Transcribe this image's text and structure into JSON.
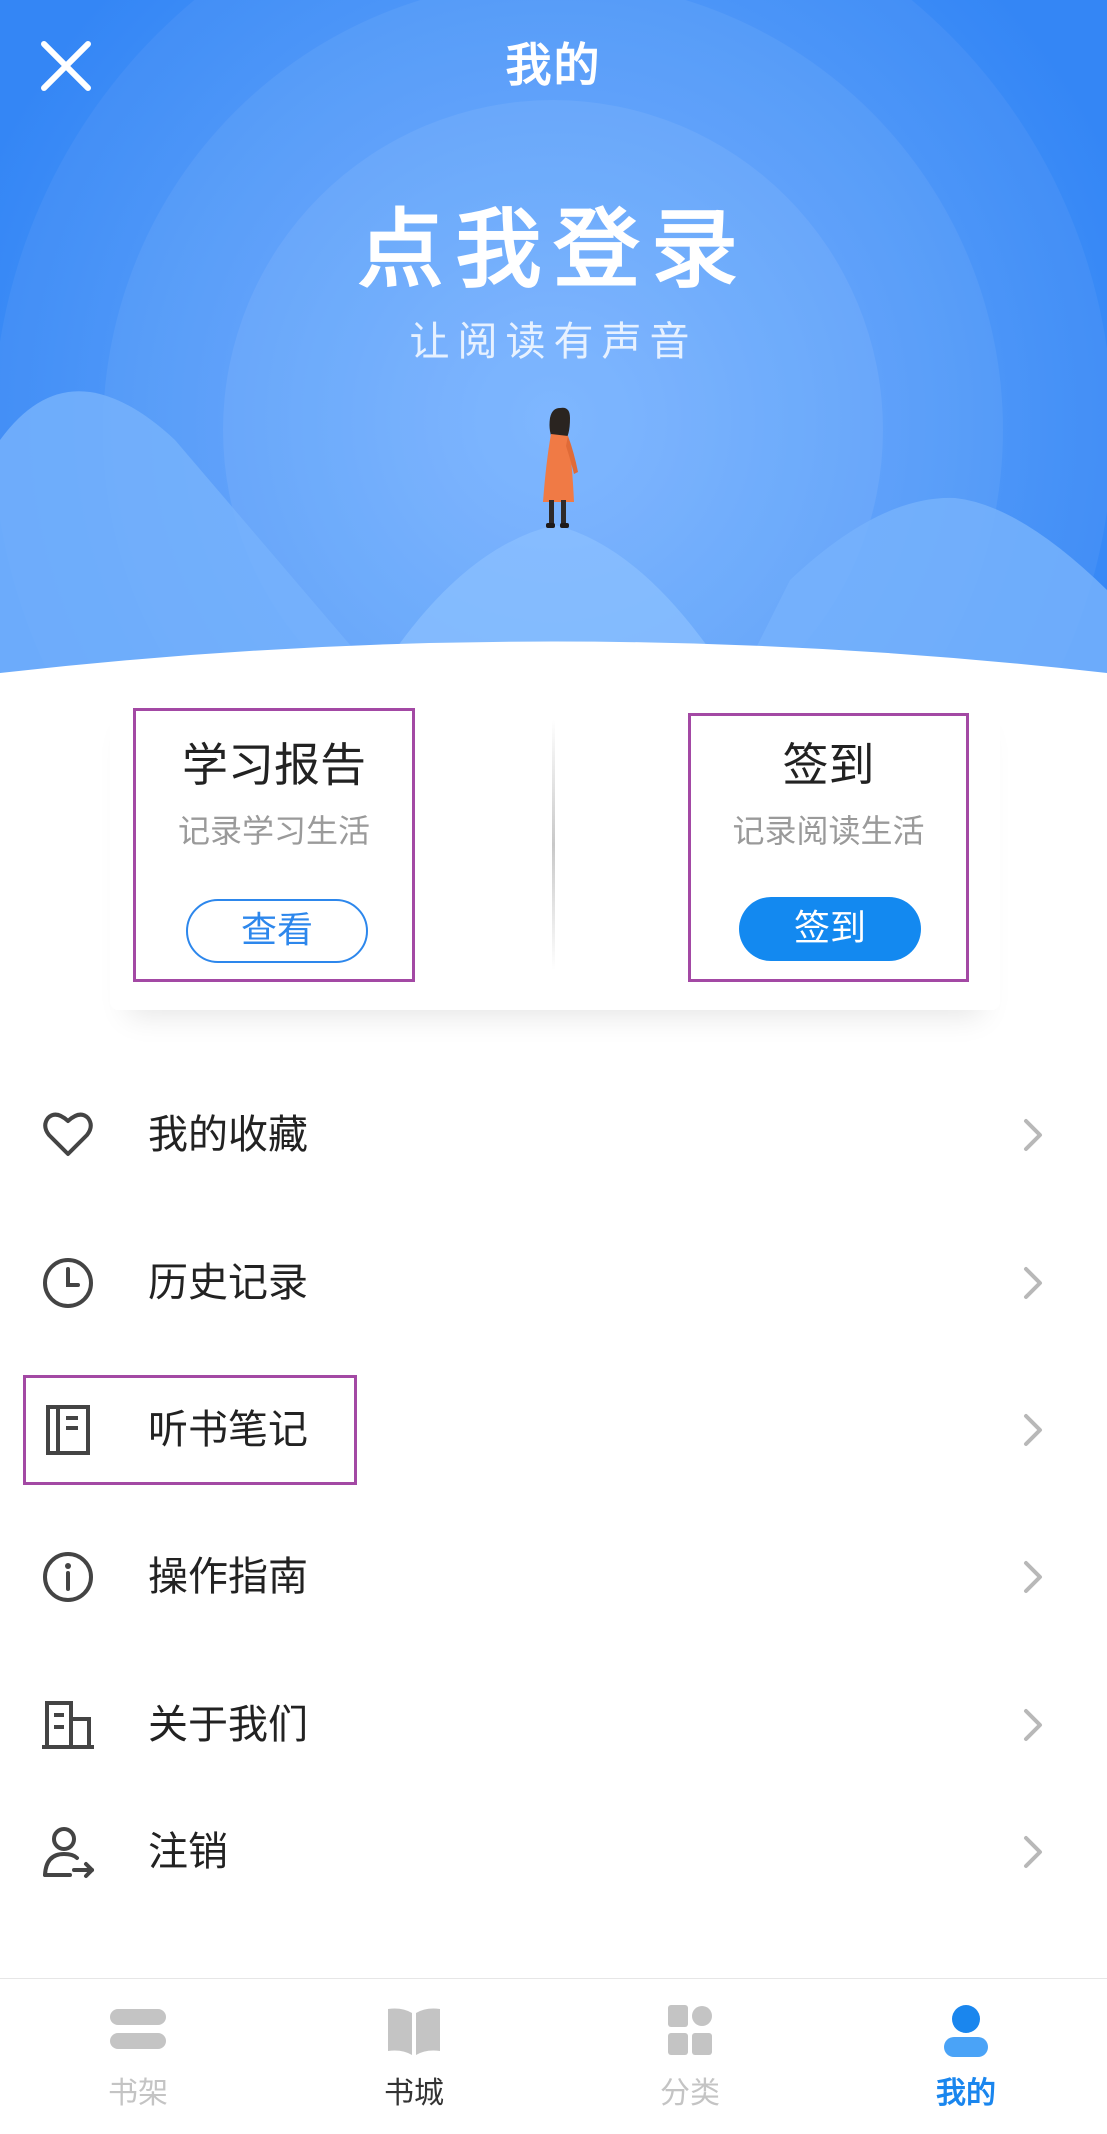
{
  "header": {
    "title": "我的",
    "login_title": "点我登录",
    "login_subtitle": "让阅读有声音"
  },
  "cards": {
    "report": {
      "title": "学习报告",
      "subtitle": "记录学习生活",
      "button": "查看"
    },
    "checkin": {
      "title": "签到",
      "subtitle": "记录阅读生活",
      "button": "签到"
    }
  },
  "menu": [
    {
      "label": "我的收藏",
      "icon": "heart-icon"
    },
    {
      "label": "历史记录",
      "icon": "clock-icon"
    },
    {
      "label": "听书笔记",
      "icon": "notebook-icon"
    },
    {
      "label": "操作指南",
      "icon": "info-icon"
    },
    {
      "label": "关于我们",
      "icon": "building-icon"
    },
    {
      "label": "注销",
      "icon": "user-logout-icon"
    }
  ],
  "tabs": [
    {
      "label": "书架",
      "icon": "bookshelf-icon",
      "state": "inactive"
    },
    {
      "label": "书城",
      "icon": "book-open-icon",
      "state": "dark"
    },
    {
      "label": "分类",
      "icon": "category-grid-icon",
      "state": "inactive"
    },
    {
      "label": "我的",
      "icon": "user-icon",
      "state": "active"
    }
  ],
  "colors": {
    "hero_blue": "#3f8ff7",
    "accent_blue": "#1389f0",
    "highlight_purple": "#a349a4",
    "tab_inactive": "#c4c4c4",
    "tab_dark": "#333333",
    "tab_active": "#1a86ee"
  }
}
